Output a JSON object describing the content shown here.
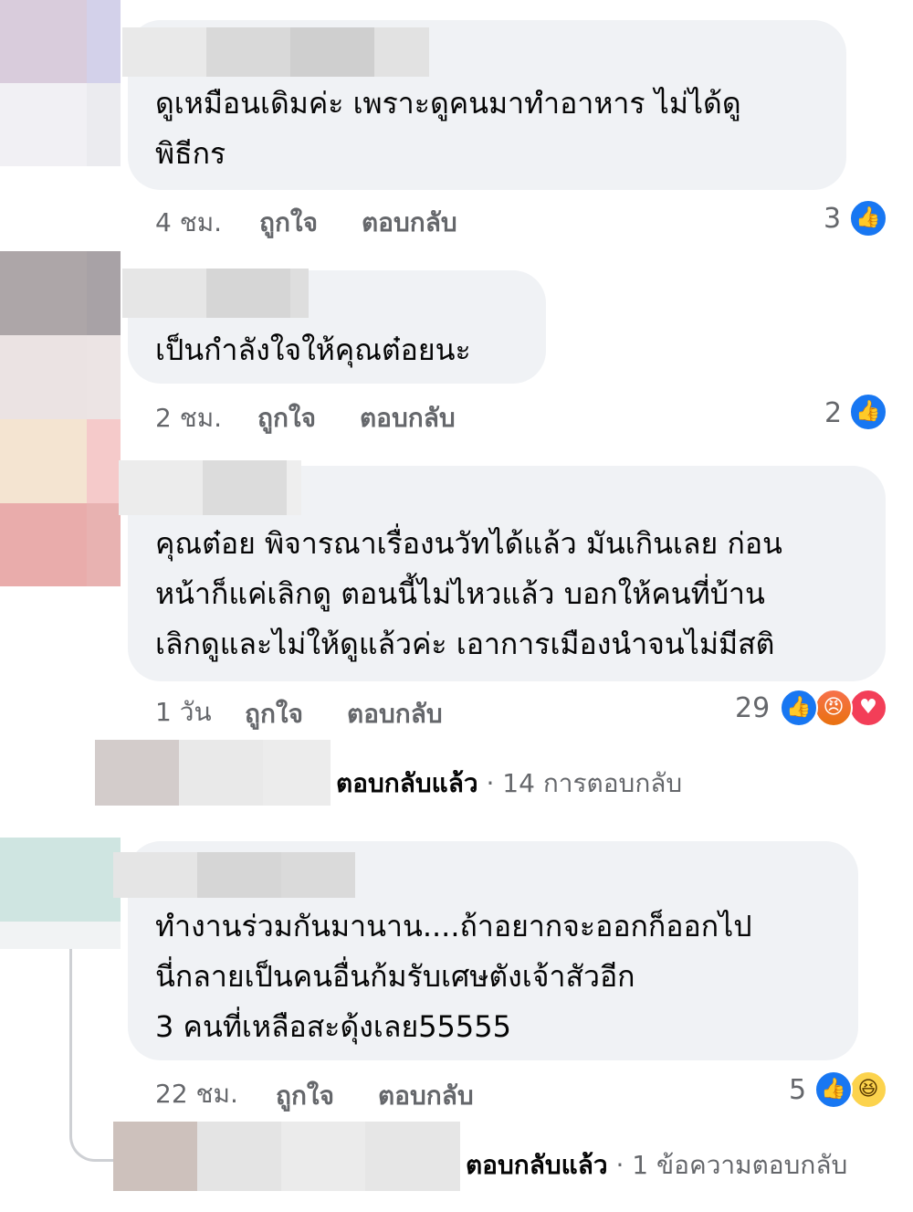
{
  "comments": [
    {
      "text": "ดูเหมือนเดิมค่ะ  เพราะดูคนมาทำอาหาร ไม่ได้ดู\nพิธีกร",
      "time": "4 ชม.",
      "like_label": "ถูกใจ",
      "reply_label": "ตอบกลับ",
      "reaction_count": "3",
      "reactions": [
        "like-icon"
      ]
    },
    {
      "text": "เป็นกำลังใจให้คุณต๋อยนะ",
      "time": "2 ชม.",
      "like_label": "ถูกใจ",
      "reply_label": "ตอบกลับ",
      "reaction_count": "2",
      "reactions": [
        "like-icon"
      ]
    },
    {
      "text": "คุณต๋อย พิจารณาเรื่องนวัทได้แล้ว มันเกินเลย ก่อน\nหน้าก็แค่เลิกดู ตอนนี้ไม่ไหวแล้ว บอกให้คนที่บ้าน\nเลิกดูและไม่ให้ดูแล้วค่ะ เอาการเมืองนำจนไม่มีสติ",
      "time": "1 วัน",
      "like_label": "ถูกใจ",
      "reply_label": "ตอบกลับ",
      "reaction_count": "29",
      "reactions": [
        "like-icon",
        "angry-icon",
        "love-icon"
      ],
      "replies_summary": {
        "label": "ตอบกลับแล้ว",
        "count": "· 14 การตอบกลับ"
      }
    },
    {
      "text": "ทำงานร่วมกันมานาน....ถ้าอยากจะออกก็ออกไป\nนี่กลายเป็นคนอื่นก้มรับเศษตังเจ้าสัวอีก\n3 คนที่เหลือสะดุ้งเลย55555",
      "time": "22 ชม.",
      "like_label": "ถูกใจ",
      "reply_label": "ตอบกลับ",
      "reaction_count": "5",
      "reactions": [
        "like-icon",
        "haha-icon"
      ],
      "replies_summary": {
        "label": "ตอบกลับแล้ว",
        "count": "· 1 ข้อความตอบกลับ"
      }
    }
  ],
  "colors": {
    "bubble": "#f0f2f5",
    "meta_text": "#65676b",
    "like": "#1877f2",
    "love": "#f33e58",
    "angry": "#e9710f",
    "haha": "#fcd34d"
  }
}
